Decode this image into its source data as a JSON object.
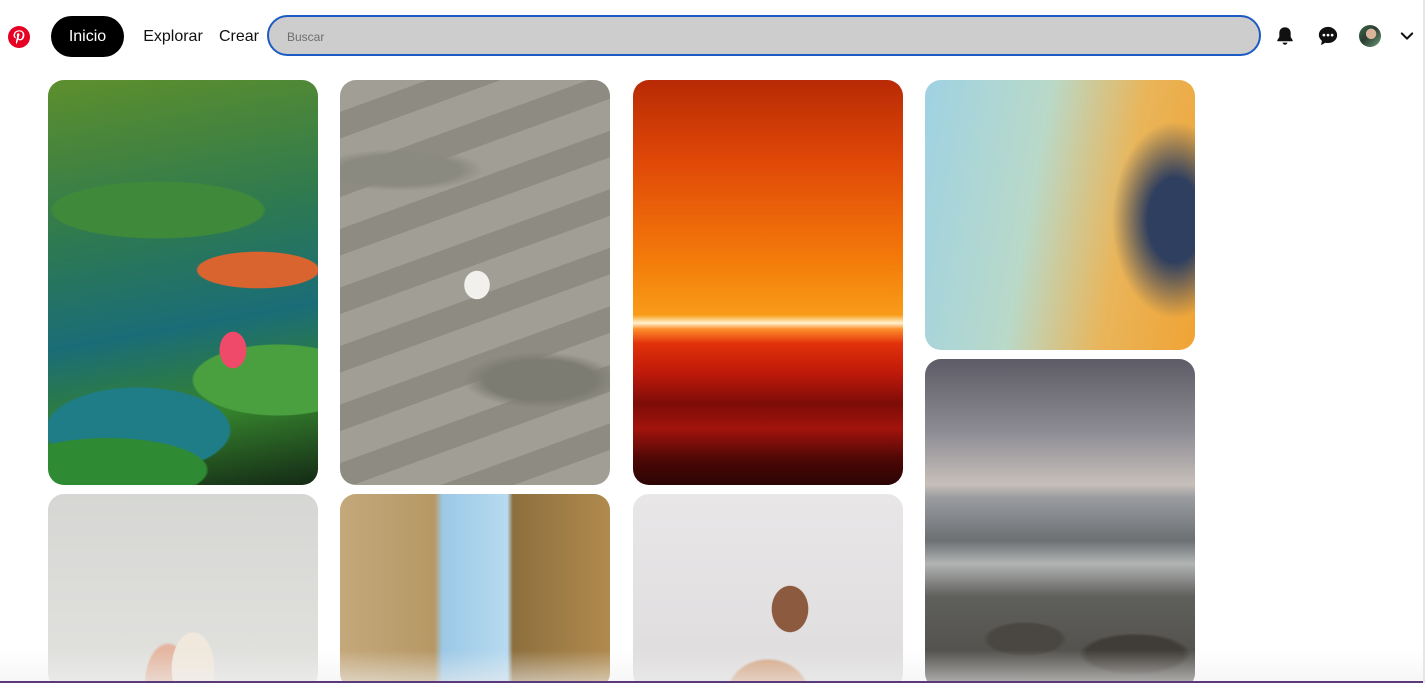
{
  "header": {
    "nav": {
      "home_label": "Inicio",
      "explore_label": "Explorar",
      "create_label": "Crear"
    },
    "search": {
      "placeholder": "Buscar",
      "value": ""
    },
    "icons": {
      "logo": "pinterest-logo-icon",
      "notifications": "bell-icon",
      "messages": "chat-bubble-icon",
      "account_menu": "chevron-down-icon"
    }
  },
  "colors": {
    "brand": "#e60023",
    "active_nav_bg": "#000000",
    "search_border": "#1d5bc4",
    "search_bg": "#cdcdcd"
  },
  "pins": [
    {
      "name": "pin-water-lilies"
    },
    {
      "name": "pin-sand-shell"
    },
    {
      "name": "pin-orange-horizon"
    },
    {
      "name": "pin-blue-plants-sky"
    },
    {
      "name": "pin-stormy-sea"
    },
    {
      "name": "pin-candle-jar"
    },
    {
      "name": "pin-narrow-street"
    },
    {
      "name": "pin-smiling-woman"
    }
  ]
}
